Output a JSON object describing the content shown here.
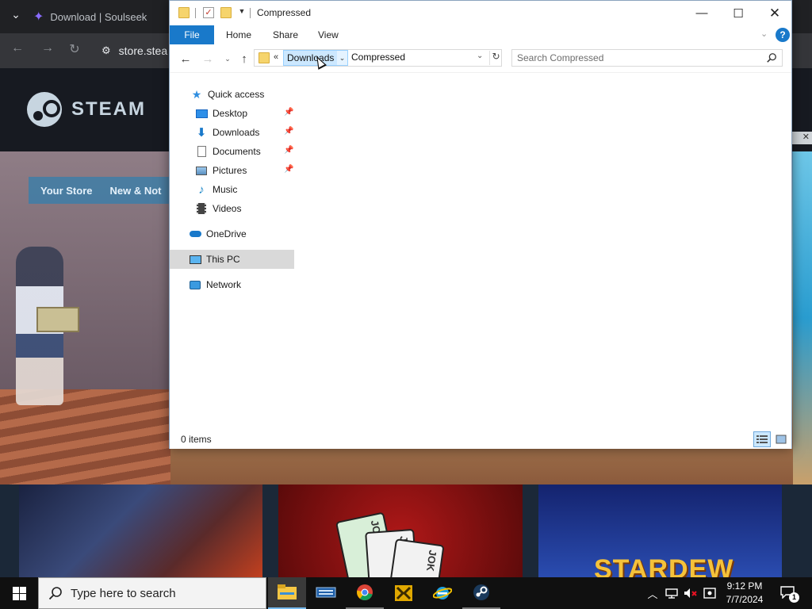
{
  "browser": {
    "tab_title": "Download | Soulseek",
    "url_text": "store.stea",
    "steam_wordmark": "STEAM",
    "nav_items": [
      "Your Store",
      "New & Not"
    ],
    "ad_close": "✕",
    "cards": [
      "JOKER",
      "JOK",
      "JOK"
    ],
    "stardew_title": "STARDEW"
  },
  "explorer": {
    "title": "Compressed",
    "ribbon_tabs": {
      "file": "File",
      "home": "Home",
      "share": "Share",
      "view": "View"
    },
    "help": "?",
    "address": {
      "overflow": "«",
      "crumbs": [
        "Downloads",
        "Compressed"
      ]
    },
    "search": {
      "placeholder": "Search Compressed"
    },
    "nav": {
      "quick_access": "Quick access",
      "desktop": "Desktop",
      "downloads": "Downloads",
      "documents": "Documents",
      "pictures": "Pictures",
      "music": "Music",
      "videos": "Videos",
      "onedrive": "OneDrive",
      "this_pc": "This PC",
      "network": "Network"
    },
    "status": {
      "item_count": "0 items"
    }
  },
  "taskbar": {
    "search_placeholder": "Type here to search",
    "time": "9:12 PM",
    "date": "7/7/2024",
    "notification_count": "1"
  },
  "colors": {
    "accent": "#1979ca",
    "selection": "#cce8ff",
    "taskbar": "#101010"
  }
}
